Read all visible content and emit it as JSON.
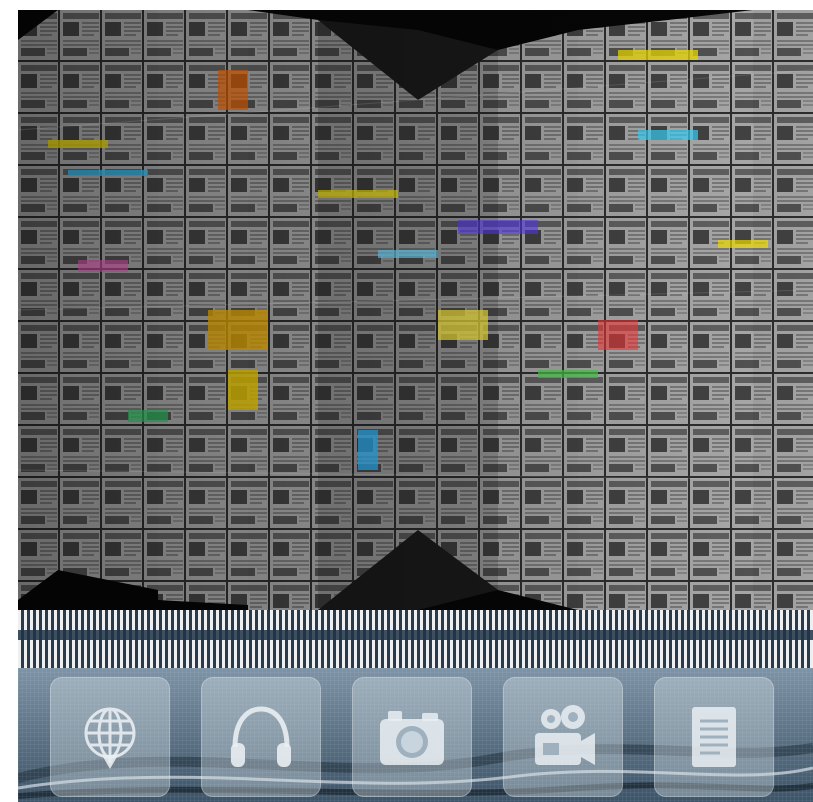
{
  "hero": {
    "description_icon": "newspaper-wall-icon"
  },
  "dock": {
    "items": [
      {
        "icon": "globe-download-icon",
        "label": ""
      },
      {
        "icon": "headphones-icon",
        "label": ""
      },
      {
        "icon": "camera-icon",
        "label": ""
      },
      {
        "icon": "video-camera-icon",
        "label": ""
      },
      {
        "icon": "document-icon",
        "label": ""
      }
    ]
  },
  "colors": {
    "dock_top": "#7d93a6",
    "dock_bottom": "#3d5468",
    "tile": "#d7e1e8",
    "hero_bg": "#050505"
  }
}
